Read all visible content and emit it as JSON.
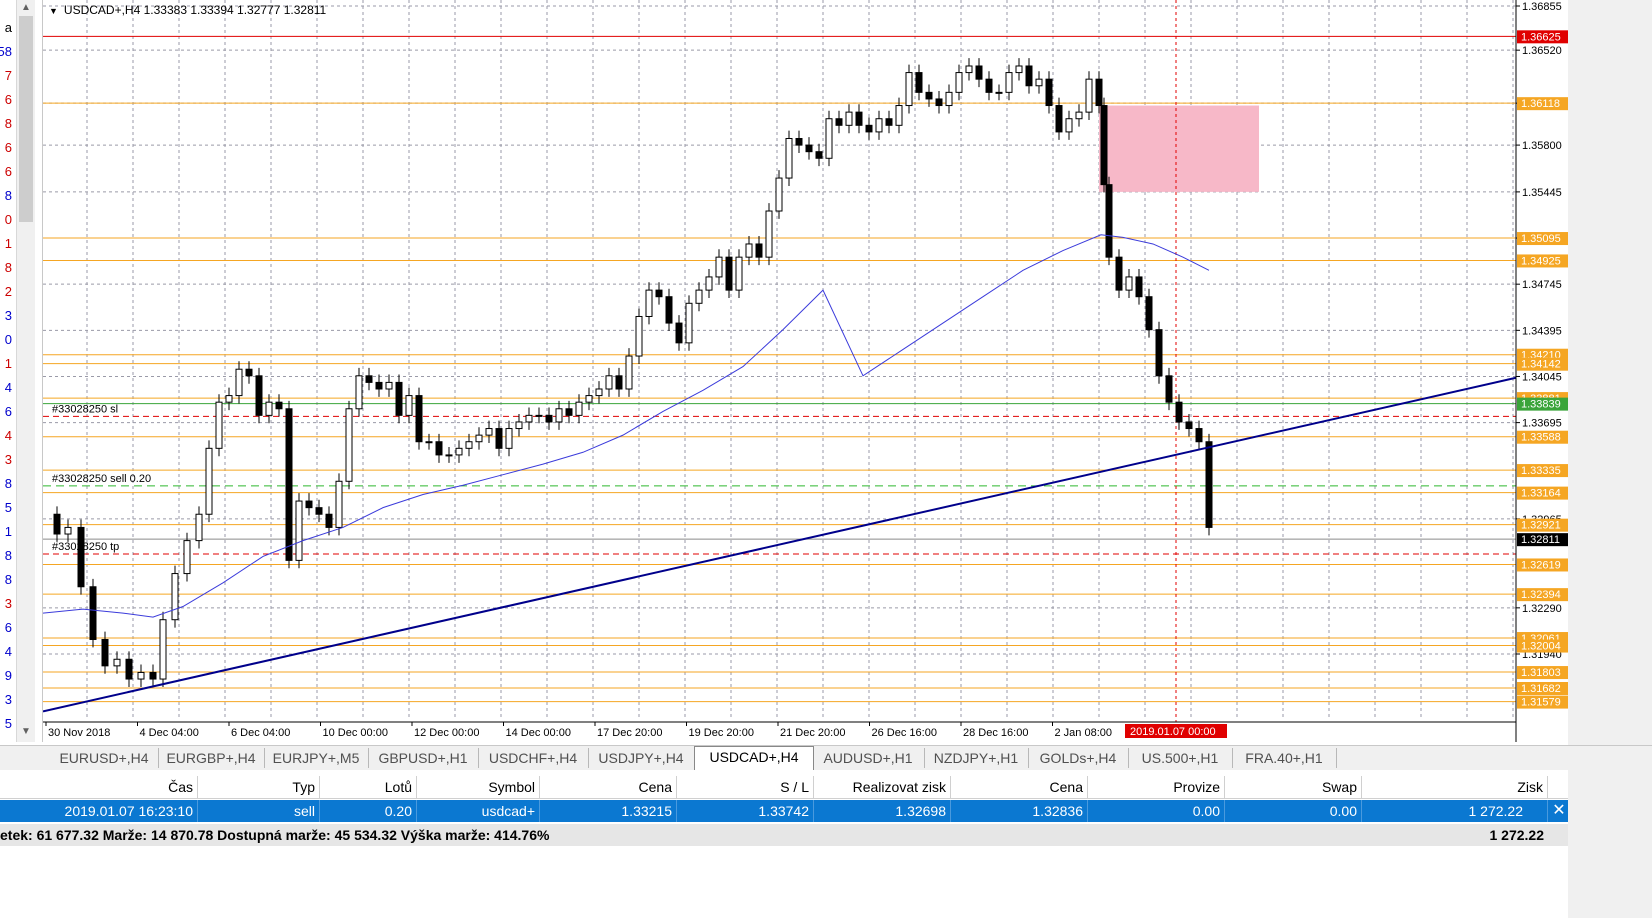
{
  "window": {
    "symbol_header": "USDCAD+,H4  1.33383 1.33394 1.32777 1.32811"
  },
  "left_strip": {
    "numbers": [
      {
        "text": "a",
        "color": "#000000"
      },
      {
        "text": "58",
        "color": "#0000cc"
      },
      {
        "text": "7",
        "color": "#cc0000"
      },
      {
        "text": "6",
        "color": "#cc0000"
      },
      {
        "text": "8",
        "color": "#cc0000"
      },
      {
        "text": "6",
        "color": "#cc0000"
      },
      {
        "text": "6",
        "color": "#cc0000"
      },
      {
        "text": "8",
        "color": "#0000cc"
      },
      {
        "text": "0",
        "color": "#cc0000"
      },
      {
        "text": "1",
        "color": "#cc0000"
      },
      {
        "text": "8",
        "color": "#cc0000"
      },
      {
        "text": "2",
        "color": "#cc0000"
      },
      {
        "text": "3",
        "color": "#0000cc"
      },
      {
        "text": "0",
        "color": "#0000cc"
      },
      {
        "text": "1",
        "color": "#cc0000"
      },
      {
        "text": "4",
        "color": "#0000cc"
      },
      {
        "text": "6",
        "color": "#0000cc"
      },
      {
        "text": "4",
        "color": "#cc0000"
      },
      {
        "text": "3",
        "color": "#cc0000"
      },
      {
        "text": "8",
        "color": "#0000cc"
      },
      {
        "text": "5",
        "color": "#0000cc"
      },
      {
        "text": "1",
        "color": "#0000cc"
      },
      {
        "text": "8",
        "color": "#0000cc"
      },
      {
        "text": "8",
        "color": "#0000cc"
      },
      {
        "text": "3",
        "color": "#cc0000"
      },
      {
        "text": "6",
        "color": "#0000cc"
      },
      {
        "text": "4",
        "color": "#0000cc"
      },
      {
        "text": "9",
        "color": "#0000cc"
      },
      {
        "text": "3",
        "color": "#0000cc"
      },
      {
        "text": "5",
        "color": "#0000cc"
      }
    ]
  },
  "chart": {
    "colors": {
      "level_line": "#f5a623",
      "red_line": "#e00000",
      "ma": "#3b3bdb",
      "trend": "#00008b",
      "zone": "#f7b8c8",
      "grid": "#9a9aa8"
    },
    "price_axis": [
      "1.36855",
      "1.36520",
      "1.36118",
      "1.35800",
      "1.35445",
      "1.35095",
      "1.34745",
      "1.34395",
      "1.34045",
      "1.33695",
      "1.32965",
      "1.32290",
      "1.31940"
    ],
    "price_tags": [
      {
        "text": "1.36625",
        "bg": "#e00000",
        "fg": "#ffffff"
      },
      {
        "text": "1.36118",
        "bg": "#f5a623",
        "fg": "#ffffff"
      },
      {
        "text": "1.35095",
        "bg": "#f5a623",
        "fg": "#ffffff"
      },
      {
        "text": "1.34925",
        "bg": "#f5a623",
        "fg": "#ffffff"
      },
      {
        "text": "1.34210",
        "bg": "#f5a623",
        "fg": "#ffffff"
      },
      {
        "text": "1.34142",
        "bg": "#f5a623",
        "fg": "#ffffff"
      },
      {
        "text": "1.33881",
        "bg": "#f5a623",
        "fg": "#ffffff"
      },
      {
        "text": "1.33839",
        "bg": "#3aa43a",
        "fg": "#ffffff"
      },
      {
        "text": "1.33588",
        "bg": "#f5a623",
        "fg": "#ffffff"
      },
      {
        "text": "1.33335",
        "bg": "#f5a623",
        "fg": "#ffffff"
      },
      {
        "text": "1.33164",
        "bg": "#f5a623",
        "fg": "#ffffff"
      },
      {
        "text": "1.32921",
        "bg": "#f5a623",
        "fg": "#ffffff"
      },
      {
        "text": "1.32811",
        "bg": "#000000",
        "fg": "#ffffff"
      },
      {
        "text": "1.32619",
        "bg": "#f5a623",
        "fg": "#ffffff"
      },
      {
        "text": "1.32394",
        "bg": "#f5a623",
        "fg": "#ffffff"
      },
      {
        "text": "1.32061",
        "bg": "#f5a623",
        "fg": "#ffffff"
      },
      {
        "text": "1.32004",
        "bg": "#f5a623",
        "fg": "#ffffff"
      },
      {
        "text": "1.31803",
        "bg": "#f5a623",
        "fg": "#ffffff"
      },
      {
        "text": "1.31682",
        "bg": "#f5a623",
        "fg": "#ffffff"
      },
      {
        "text": "1.31579",
        "bg": "#f5a623",
        "fg": "#ffffff"
      }
    ],
    "time_axis": [
      "30 Nov 2018",
      "4 Dec 04:00",
      "6 Dec 04:00",
      "10 Dec 00:00",
      "12 Dec 00:00",
      "14 Dec 00:00",
      "17 Dec 20:00",
      "19 Dec 20:00",
      "21 Dec 20:00",
      "26 Dec 16:00",
      "28 Dec 16:00",
      "2 Jan 08:00"
    ],
    "time_cursor_label": "2019.01.07 00:00",
    "order_labels": {
      "sl": "#33028250 sl",
      "entry": "#33028250 sell 0.20",
      "tp": "#33028250 tp"
    }
  },
  "tabs": [
    {
      "label": "EURUSD+,H4",
      "active": false
    },
    {
      "label": "EURGBP+,H4",
      "active": false
    },
    {
      "label": "EURJPY+,M5",
      "active": false
    },
    {
      "label": "GBPUSD+,H1",
      "active": false
    },
    {
      "label": "USDCHF+,H4",
      "active": false
    },
    {
      "label": "USDJPY+,H4",
      "active": false
    },
    {
      "label": "USDCAD+,H4",
      "active": true
    },
    {
      "label": "AUDUSD+,H1",
      "active": false
    },
    {
      "label": "NZDJPY+,H1",
      "active": false
    },
    {
      "label": "GOLDs+,H4",
      "active": false
    },
    {
      "label": "US.500+,H1",
      "active": false
    },
    {
      "label": "FRA.40+,H1",
      "active": false
    }
  ],
  "trade_table": {
    "headers": [
      "Čas",
      "Typ",
      "Lotů",
      "Symbol",
      "Cena",
      "S / L",
      "Realizovat zisk",
      "Cena",
      "Provize",
      "Swap",
      "Zisk"
    ],
    "row": [
      "2019.01.07 16:23:10",
      "sell",
      "0.20",
      "usdcad+",
      "1.33215",
      "1.33742",
      "1.32698",
      "1.32836",
      "0.00",
      "0.00",
      "1 272.22"
    ],
    "close_icon": "close-icon"
  },
  "summary": {
    "text": "etek: 61 677.32  Marže: 14 870.78  Dostupná marže: 45 534.32  Výška marže: 414.76%",
    "total": "1 272.22"
  }
}
